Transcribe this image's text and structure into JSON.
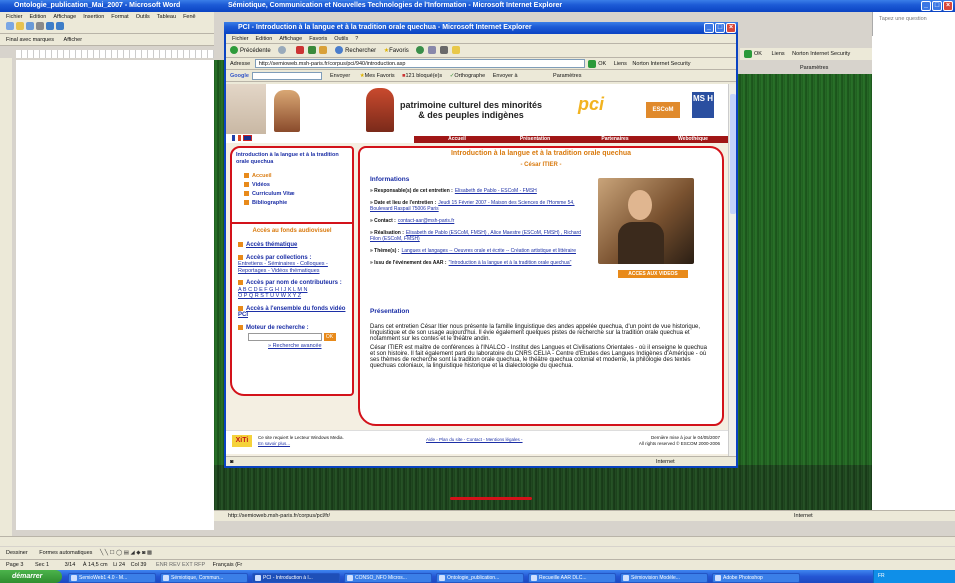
{
  "word": {
    "title": "Ontologie_publication_Mai_2007 - Microsoft Word",
    "menu": [
      "Fichier",
      "Edition",
      "Affichage",
      "Insertion",
      "Format",
      "Outils",
      "Tableau",
      "Fenê"
    ],
    "toolbar2": [
      "Final avec marques",
      "Afficher"
    ],
    "status": {
      "page": "Page 3",
      "section": "Sec 1",
      "pages": "3/14",
      "at": "À 14,5 cm",
      "line": "Li 24",
      "col": "Col 39",
      "modes": "ENR  REV  EXT  RFP",
      "lang": "Français (Fr"
    },
    "draw_toolbar": {
      "dessiner": "Dessiner",
      "formes": "Formes automatiques"
    }
  },
  "ie_outer": {
    "title": "Sémiotique, Communication et Nouvelles Technologies de l'Information - Microsoft Internet Explorer",
    "ask": "Tapez une question",
    "links_label": "Liens",
    "norton": "Norton Internet Security",
    "ok": "OK",
    "params": "Paramètres",
    "address": "http://semioweb.msh-paris.fr/corpus/pcl/fr/",
    "status": "Internet"
  },
  "ie_inner": {
    "title": "PCI - Introduction à la langue et à la tradition orale quechua - Microsoft Internet Explorer",
    "menu": [
      "Fichier",
      "Edition",
      "Affichage",
      "Favoris",
      "Outils",
      "?"
    ],
    "back": "Précédente",
    "search": "Rechercher",
    "favorites": "Favoris",
    "address_label": "Adresse",
    "address": "http://semioweb.msh-paris.fr/corpus/pci/940/introduction.asp",
    "ok": "OK",
    "links": "Liens",
    "norton": "Norton Internet Security",
    "google": "Google",
    "envoyer": "Envoyer",
    "mes_favoris": "Mes Favoris",
    "bloques": "121 bloqué(e)s",
    "ortho": "Orthographe",
    "envoyer_a": "Envoyer à",
    "params": "Paramètres",
    "status": "Internet"
  },
  "site": {
    "header_line1": "patrimoine culturel des minorités",
    "header_line2": "& des peuples indigènes",
    "logo_pci": "pci",
    "logo_escom": "ESCoM",
    "logo_msh": "MS H",
    "nav": [
      "Accueil",
      "Présentation",
      "Partenaires",
      "Webothèque"
    ],
    "left_title": "Introduction à la langue et à la tradition orale quechua",
    "left_menu": [
      "Accueil",
      "Vidéos",
      "Curriculum Vitæ",
      "Bibliographie"
    ],
    "fonds_title": "Accès au fonds audiovisuel",
    "acces_thematique": "Accès thématique",
    "acces_collections": "Accès par collections :",
    "collections_links": "Entretiens - Séminaires - Colloques - Reportages - Vidéos thématiques",
    "acces_contrib": "Accès par nom de contributeurs :",
    "alphabet1": "A B C D E F G H I J K L M N",
    "alphabet2": "O P Q R S T U V W X Y Z",
    "acces_ensemble": "Accès à l'ensemble du fonds vidéo PCI",
    "moteur": "Moteur de recherche :",
    "go": "OK",
    "recherche_avancee": "» Recherche avancée",
    "main_title": "Introduction à la langue et à la tradition orale quechua",
    "author": "- César  ITIER -",
    "info_title": "Informations",
    "info": [
      {
        "label": "» Responsable(s) de cet entretien :",
        "value": "Elisabeth de Pablo - ESCoM - FMSH"
      },
      {
        "label": "» Date et lieu de l'entretien :",
        "value": "Jeudi 15 Février 2007 - Maison des Sciences de l'Homme 54, Boulevard Raspail 75006 Paris"
      },
      {
        "label": "» Contact :",
        "value": "contact-aar@msh-paris.fr"
      },
      {
        "label": "» Réalisation :",
        "value": "Elisabeth de Pablo (ESCoM, FMSH) , Alice Maestre (ESCoM, FMSH) , Richard Filon (ESCoM, FMSH)"
      },
      {
        "label": "» Thème(s) :",
        "value": "Langues et langages -- Oeuvres orale et écrite -- Création artistique et littéraire"
      },
      {
        "label": "» Issu de l'événement des AAR :",
        "value": "\"Introduction à la langue et à la tradition orale quechua\""
      }
    ],
    "videos_btn": "ACCES AUX VIDEOS",
    "pres_title": "Présentation",
    "pres_p1": "Dans cet entretien César Itier nous présente la famille linguistique des andes appelée quechua, d'un point de vue historique, linguistique et de son usage aujourd'hui. Il évie également quelques pistes de recherche sur la tradition orale quechua et notamment sur les contes et le théâtre andin.",
    "pres_p2": "César ITIER est maître de conférences à l'INALCO - Institut des Langues et Civilisations Orientales - où il enseigne le quechua et son histoire. Il fait également parti du laboratoire du CNRS CELIA - Centre d'Etudes des Langues Indigènes d'Amérique - où ses thèmes de recherche sont la tradition orale quechua, le théâtre quechua colonial et moderne, la philologie des textes quechuas coloniaux, la linguistique historique et la dialectologie du quechua.",
    "footer_wm": "Ce site requiert le Lecteur Windows Media.",
    "footer_wm2": "En savoir plus...",
    "footer_links": "Aide - Plan du site - Contact - Mentions légales -",
    "footer_date": "Dernière mise à jour le 04/05/2007",
    "footer_rights": "All rights reserved © ESCOM 2000-2006",
    "xiti": "XiTi"
  },
  "taskbar": {
    "start": "démarrer",
    "items": [
      "SemioWeb1 4.0 - M...",
      "Sémiotique, Commun...",
      "PCI - Introduction à l...",
      "CONSO_NFO Micros...",
      "Ontologie_publication...",
      "Recueille AAR DLC...",
      "Sémiovision Modèle...",
      "Adobe Photoshop"
    ],
    "lang": "FR"
  },
  "colors": {
    "xp_blue": "#0a43c2",
    "green_bg": "#2c782c",
    "annotation_red": "#d3121a",
    "site_orange": "#e88a1a",
    "nav_red": "#a01616"
  }
}
